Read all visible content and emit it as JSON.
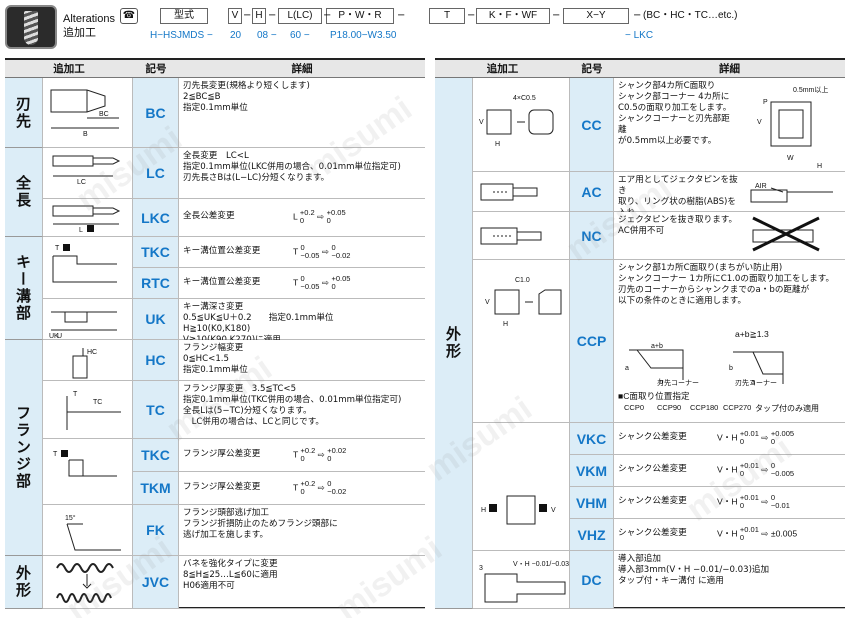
{
  "header": {
    "title_en": "Alterations",
    "title_jp": "追加工",
    "code_boxes": [
      "型式",
      "V",
      "H",
      "L(LC)",
      "P・W・R",
      "T",
      "K・F・WF",
      "X−Y"
    ],
    "code_tail": "(BC・HC・TC…etc.)",
    "example": [
      "H−HSJMDS",
      "20",
      "08",
      "60",
      "P18.00−W3.50",
      "LKC"
    ]
  },
  "columns": {
    "alteration": "追加工",
    "code": "記号",
    "detail": "詳細"
  },
  "left_rows": [
    {
      "code": "BC",
      "detail": "刃先長変更(規格より短くします)\n2≦BC≦B\n指定0.1mm単位"
    },
    {
      "code": "LC",
      "detail": "全長変更　LC<L\n指定0.1mm単位(LKC併用の場合、0.01mm単位指定可)\n刃先長さBは(L−LC)分短くなります。"
    },
    {
      "code": "LKC",
      "detail": "全長公差変更",
      "tol": "L +0.2/0 ⇨ +0.05/0"
    },
    {
      "code": "TKC",
      "detail": "キー溝位置公差変更",
      "tol": "T 0/−0.05 ⇨ 0/−0.02"
    },
    {
      "code": "RTC",
      "detail": "キー溝位置公差変更",
      "tol": "T 0/−0.05 ⇨ +0.05/0"
    },
    {
      "code": "UK",
      "detail": "キー溝深さ変更\n0.5≦UK≦U＋0.2　　指定0.1mm単位\nH≧10(K0,K180)\nV≧10(K90,K270)に適用"
    },
    {
      "code": "HC",
      "detail": "フランジ幅変更\n0≦HC<1.5\n指定0.1mm単位"
    },
    {
      "code": "TC",
      "detail": "フランジ厚変更　3.5≦TC<5\n指定0.1mm単位(TKC併用の場合、0.01mm単位指定可)\n全長Lは(5−TC)分短くなります。\n　LC併用の場合は、LCと同じです。"
    },
    {
      "code": "TKC",
      "detail": "フランジ厚公差変更",
      "tol": "T +0.2/0 ⇨ +0.02/0"
    },
    {
      "code": "TKM",
      "detail": "フランジ厚公差変更",
      "tol": "T +0.2/0 ⇨ 0/−0.02"
    },
    {
      "code": "FK",
      "detail": "フランジ頭部逃げ加工\nフランジ折損防止のためフランジ頭部に\n逃げ加工を施します。"
    },
    {
      "code": "JVC",
      "detail": "バネを強化タイプに変更\n8≦H≦25…L≦60に適用\nH06適用不可"
    }
  ],
  "left_cats": [
    "刃先",
    "全長",
    "キー溝部",
    "フランジ部",
    "外形"
  ],
  "right_cat": "外形",
  "right_rows": [
    {
      "code": "CC",
      "detail": "シャンク部4カ所C面取り\nシャンク部コーナー 4カ所に\nC0.5の面取り加工をします。\nシャンクコーナーと刃先部距離\nが0.5mm以上必要です。"
    },
    {
      "code": "AC",
      "detail": "エア用としてジェクタピンを抜き\n取り、リング状の樹脂(ABS)を入れ\nて内側から横穴をふさぎます。"
    },
    {
      "code": "NC",
      "detail": "ジェクタピンを抜き取ります。\nAC併用不可"
    },
    {
      "code": "CCP",
      "detail": "シャンク部1カ所C面取り(まちがい防止用)\nシャンクコーナー 1カ所にC1.0の面取り加工をします。\n刃先のコーナーからシャンクまでのa・bの距離が\n以下の条件のときに適用します。"
    },
    {
      "code": "VKC",
      "detail": "シャンク公差変更",
      "tol": "V・H +0.01/0 ⇨ +0.005/0"
    },
    {
      "code": "VKM",
      "detail": "シャンク公差変更",
      "tol": "V・H +0.01/0 ⇨ 0/−0.005"
    },
    {
      "code": "VHM",
      "detail": "シャンク公差変更",
      "tol": "V・H +0.01/0 ⇨ 0/−0.01"
    },
    {
      "code": "VHZ",
      "detail": "シャンク公差変更",
      "tol": "V・H +0.01/0 ⇨ ±0.005"
    },
    {
      "code": "DC",
      "detail": "導入部追加\n導入部3mm(V・H −0.01/−0.03)追加\nタップ付・キー溝付 に適用"
    }
  ],
  "ccp_extra": {
    "cond": "a+b≧1.3",
    "label": "■C面取り位置指定",
    "options": [
      "CCP0",
      "CCP90",
      "CCP180",
      "CCP270"
    ],
    "note": "タップ付のみ適用",
    "tip": "刃先コーナー"
  },
  "fig_labels": {
    "cc_c": "4×C0.5",
    "cc_min": "0.5mm以上",
    "ccp_c": "C1.0",
    "ac_air": "AIR",
    "dc_3": "3",
    "dc_vh": "V・H −0.01/−0.03"
  },
  "watermark": "misumi"
}
